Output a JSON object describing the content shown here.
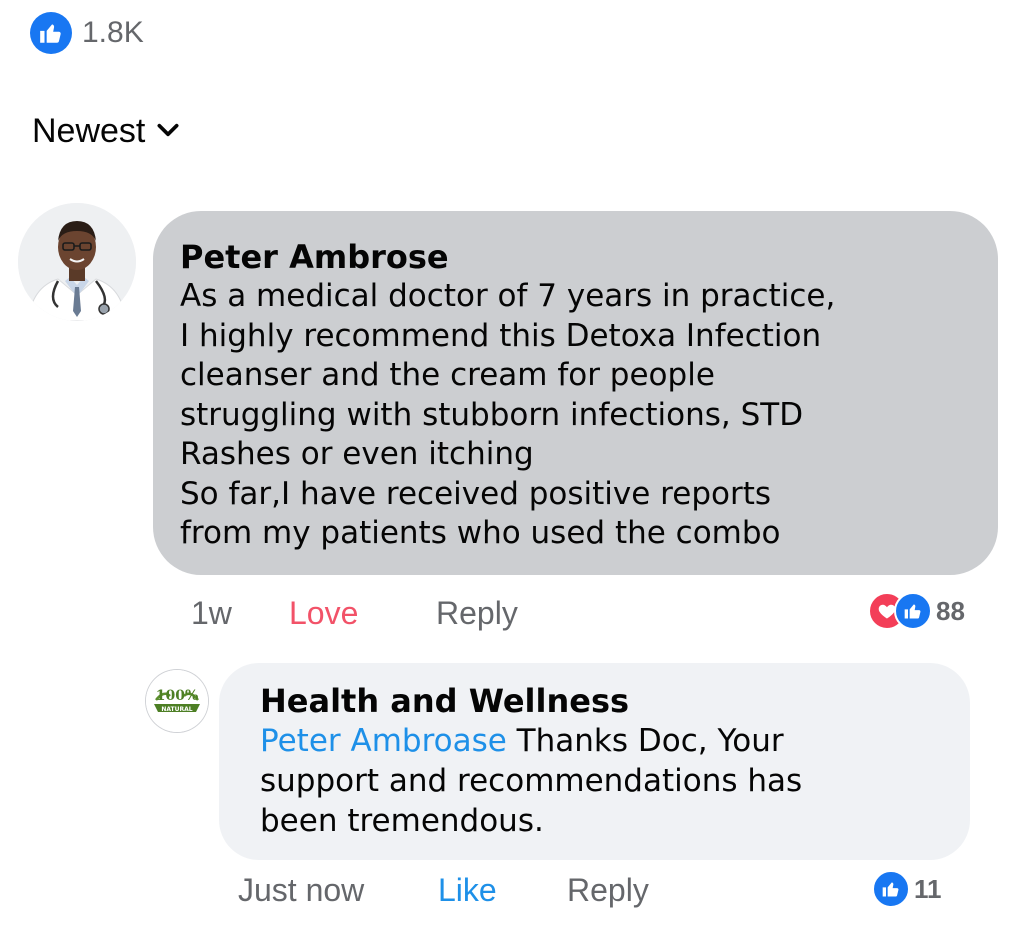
{
  "post_reactions": {
    "icon": "thumbs-up-icon",
    "count": "1.8K"
  },
  "sort": {
    "label": "Newest",
    "icon": "chevron-down-icon"
  },
  "comment": {
    "author": "Peter Ambrose",
    "lines": [
      "As a medical doctor of 7 years in practice,",
      "I highly recommend this Detoxa Infection",
      "cleanser and the cream for people",
      "struggling with stubborn infections, STD",
      "Rashes or even itching",
      "So far,I have received positive reports",
      "from my patients who used the combo"
    ],
    "time": "1w",
    "love_label": "Love",
    "reply_label": "Reply",
    "reactions": {
      "icons": [
        "heart-icon",
        "thumbs-up-icon"
      ],
      "count": "88"
    }
  },
  "reply": {
    "author": "Health and Wellness",
    "avatar_text": "100%",
    "avatar_subtext": "NATURAL",
    "mention": "Peter Ambroase",
    "text_line1": " Thanks Doc, Your",
    "lines": [
      "support and recommendations has",
      "been tremendous."
    ],
    "time": "Just now",
    "like_label": "Like",
    "reply_label": "Reply",
    "reactions": {
      "icons": [
        "thumbs-up-icon"
      ],
      "count": "11"
    }
  },
  "colors": {
    "facebook_blue": "#1877f2",
    "mention_blue": "#1e90e8",
    "love_red": "#f25268",
    "bubble_main": "#ccced1",
    "bubble_reply": "#f0f2f5",
    "muted_text": "#65676b"
  }
}
